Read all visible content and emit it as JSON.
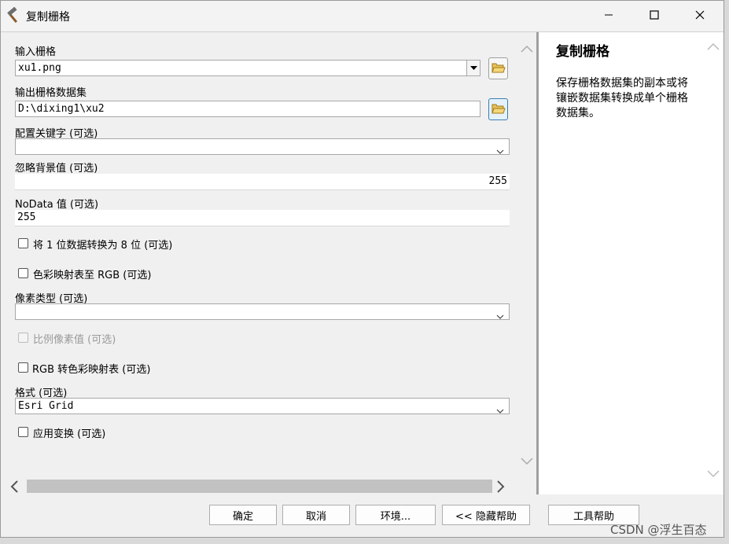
{
  "window": {
    "title": "复制栅格",
    "icon": "hammer-icon"
  },
  "form": {
    "input_raster": {
      "label": "输入栅格",
      "value": "xu1.png"
    },
    "output_dataset": {
      "label": "输出栅格数据集",
      "value": "D:\\dixing1\\xu2"
    },
    "config_keyword": {
      "label": "配置关键字 (可选)",
      "value": ""
    },
    "ignore_background": {
      "label": "忽略背景值 (可选)",
      "value": "255"
    },
    "nodata": {
      "label": "NoData 值 (可选)",
      "value": "255"
    },
    "convert_1bit": {
      "label": "将 1 位数据转换为 8 位 (可选)",
      "checked": false
    },
    "colormap_to_rgb": {
      "label": "色彩映射表至 RGB (可选)",
      "checked": false
    },
    "pixel_type": {
      "label": "像素类型 (可选)",
      "value": ""
    },
    "scale_pixel": {
      "label": "比例像素值 (可选)",
      "checked": false,
      "enabled": false
    },
    "rgb_to_colormap": {
      "label": "RGB 转色彩映射表 (可选)",
      "checked": false
    },
    "format": {
      "label": "格式 (可选)",
      "value": "Esri Grid"
    },
    "apply_transform": {
      "label": "应用变换 (可选)",
      "checked": false
    }
  },
  "help": {
    "title": "复制栅格",
    "text": "保存栅格数据集的副本或将镶嵌数据集转换成单个栅格数据集。"
  },
  "buttons": {
    "ok": "确定",
    "cancel": "取消",
    "env": "环境...",
    "hide_help": "<< 隐藏帮助",
    "tool_help": "工具帮助"
  },
  "watermark": "CSDN @浮生百态"
}
